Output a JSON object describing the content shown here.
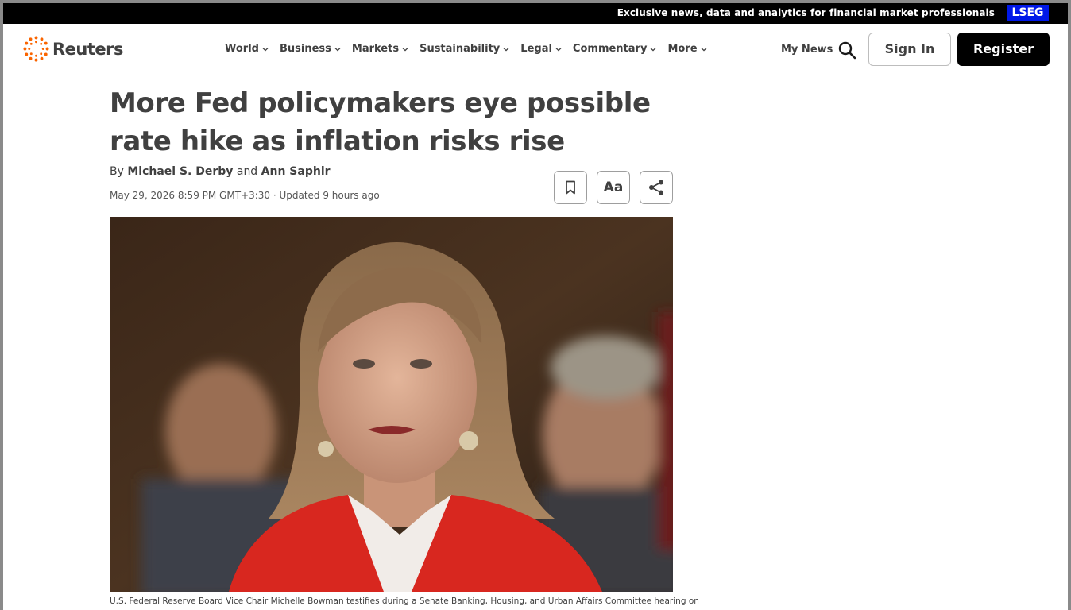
{
  "top_strip": {
    "tagline": "Exclusive news, data and analytics for financial market professionals",
    "brand_badge": "LSEG"
  },
  "header": {
    "logo_text": "Reuters",
    "nav": [
      {
        "label": "World"
      },
      {
        "label": "Business"
      },
      {
        "label": "Markets"
      },
      {
        "label": "Sustainability"
      },
      {
        "label": "Legal"
      },
      {
        "label": "Commentary"
      },
      {
        "label": "More"
      }
    ],
    "my_news": "My News",
    "sign_in": "Sign In",
    "register": "Register"
  },
  "article": {
    "headline": "More Fed policymakers eye possible rate hike as inflation risks rise",
    "byline_prefix": "By",
    "author1": "Michael S. Derby",
    "byline_and": "and",
    "author2": "Ann Saphir",
    "dateline": "May 29, 2026 8:59 PM GMT+3:30 · Updated 9 hours ago",
    "text_size_label": "Aa",
    "caption": "U.S. Federal Reserve Board Vice Chair Michelle Bowman testifies during a Senate Banking, Housing, and Urban Affairs Committee hearing on"
  },
  "colors": {
    "text": "#404040",
    "brand_orange": "#fa6400",
    "lseg_blue": "#0018e8"
  }
}
